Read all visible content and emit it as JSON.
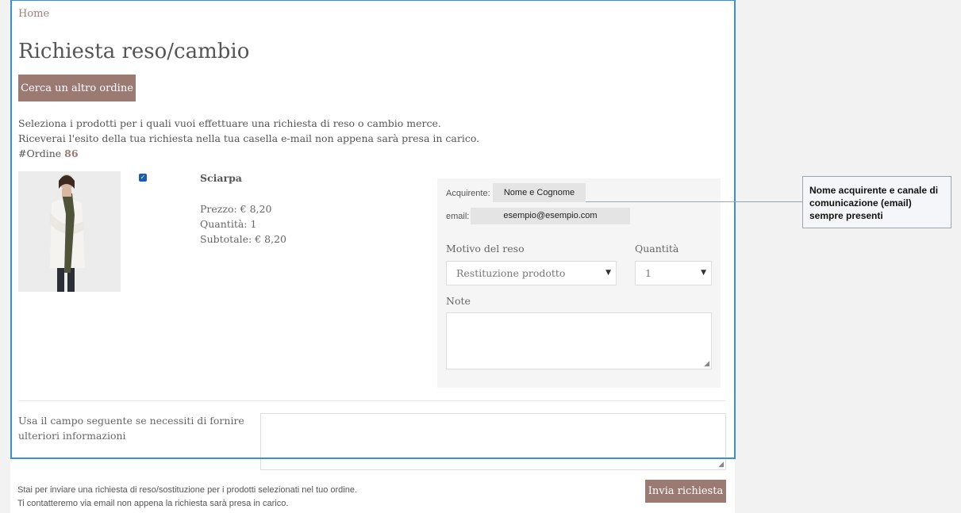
{
  "breadcrumb": "Home",
  "title": "Richiesta reso/cambio",
  "search_button": "Cerca un altro ordine",
  "intro": {
    "line1": "Seleziona i prodotti per i quali vuoi effettuare una richiesta di reso o cambio merce.",
    "line2": "Riceverai l'esito della tua richiesta nella tua casella e-mail non appena sarà presa in carico.",
    "order_prefix": "#Ordine",
    "order_number": "86"
  },
  "product": {
    "name": "Sciarpa",
    "price": "Prezzo: € 8,20",
    "quantity": "Quantità: 1",
    "subtotal": "Subtotale: € 8,20",
    "selected": true
  },
  "form": {
    "buyer_label": "Acquirente:",
    "buyer_value": "Nome e Cognome",
    "email_label": "email:",
    "email_value": "esempio@esempio.com",
    "reason_label": "Motivo del reso",
    "reason_value": "Restituzione prodotto",
    "quantity_label": "Quantità",
    "quantity_value": "1",
    "notes_label": "Note"
  },
  "extra_info_label": "Usa il campo seguente se necessiti di fornire ulteriori informazioni",
  "footer": {
    "line1": "Stai per inviare una richiesta di reso/sostituzione per i prodotti selezionati nel tuo ordine.",
    "line2": "Ti contatteremo via email non appena la richiesta sarà presa in carico."
  },
  "submit_button": "Invia richiesta",
  "callout": "Nome acquirente e canale di comunicazione (email) sempre presenti",
  "colors": {
    "accent": "#9b7a74",
    "highlight_border": "#3b8de0",
    "checkbox": "#1a5bb5"
  }
}
